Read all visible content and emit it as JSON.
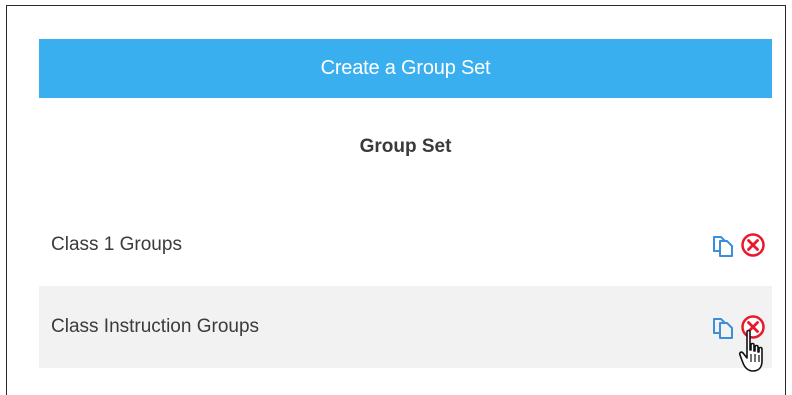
{
  "header": {
    "create_label": "Create a Group Set",
    "section_title": "Group Set"
  },
  "group_sets": [
    {
      "name": "Class 1 Groups"
    },
    {
      "name": "Class Instruction Groups"
    }
  ],
  "icons": {
    "copy": "copy-icon",
    "delete": "delete-icon"
  },
  "colors": {
    "primary": "#3aafef",
    "copy_icon": "#3a8fdc",
    "delete_icon": "#e8192c",
    "row_alt": "#f2f2f2"
  }
}
